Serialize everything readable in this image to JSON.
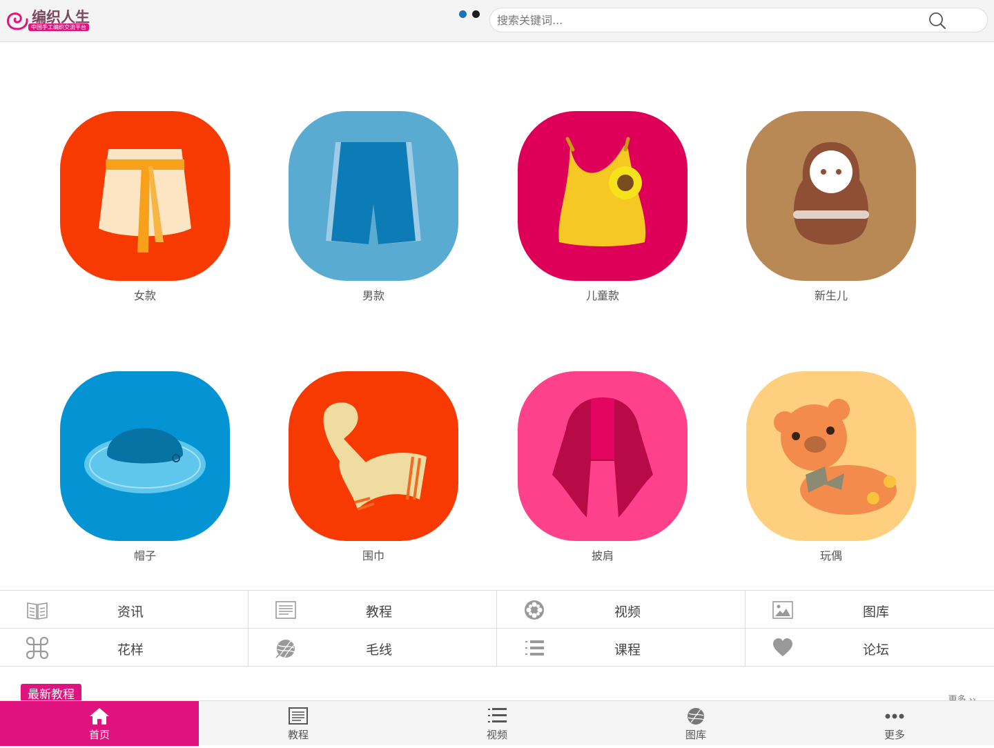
{
  "header": {
    "logo": {
      "name": "编织人生",
      "tagline": "中国手工编织交流平台"
    },
    "pager_dots": [
      {
        "active": true
      },
      {
        "active": false
      }
    ],
    "search": {
      "placeholder": "搜索关键词..."
    }
  },
  "categories": [
    {
      "label": "女款",
      "color": "#f63a02",
      "icon": "skirt-icon"
    },
    {
      "label": "男款",
      "color": "#5aabd1",
      "icon": "shorts-icon"
    },
    {
      "label": "儿童款",
      "color": "#de0058",
      "icon": "tank-top-icon"
    },
    {
      "label": "新生儿",
      "color": "#b88954",
      "icon": "doll-icon"
    },
    {
      "label": "帽子",
      "color": "#0494d3",
      "icon": "hat-icon"
    },
    {
      "label": "围巾",
      "color": "#f63a02",
      "icon": "scarf-icon"
    },
    {
      "label": "披肩",
      "color": "#fd418b",
      "icon": "shawl-icon"
    },
    {
      "label": "玩偶",
      "color": "#fecf7f",
      "icon": "teddy-bear-icon"
    }
  ],
  "quick_links": [
    {
      "label": "资讯",
      "icon": "book-icon"
    },
    {
      "label": "教程",
      "icon": "document-icon"
    },
    {
      "label": "视频",
      "icon": "film-reel-icon"
    },
    {
      "label": "图库",
      "icon": "image-icon"
    },
    {
      "label": "花样",
      "icon": "command-icon"
    },
    {
      "label": "毛线",
      "icon": "yarn-ball-icon"
    },
    {
      "label": "课程",
      "icon": "numbered-list-icon"
    },
    {
      "label": "论坛",
      "icon": "heart-icon"
    }
  ],
  "section": {
    "title": "最新教程",
    "more": "更多 ››"
  },
  "bottom_nav": [
    {
      "label": "首页",
      "icon": "home-icon",
      "active": true
    },
    {
      "label": "教程",
      "icon": "document-icon",
      "active": false
    },
    {
      "label": "视频",
      "icon": "list-icon",
      "active": false
    },
    {
      "label": "图库",
      "icon": "yarn-ball-icon",
      "active": false
    },
    {
      "label": "更多",
      "icon": "more-dots-icon",
      "active": false
    }
  ],
  "colors": {
    "brand": "#e0127e",
    "active_dot": "#1d75b8"
  }
}
